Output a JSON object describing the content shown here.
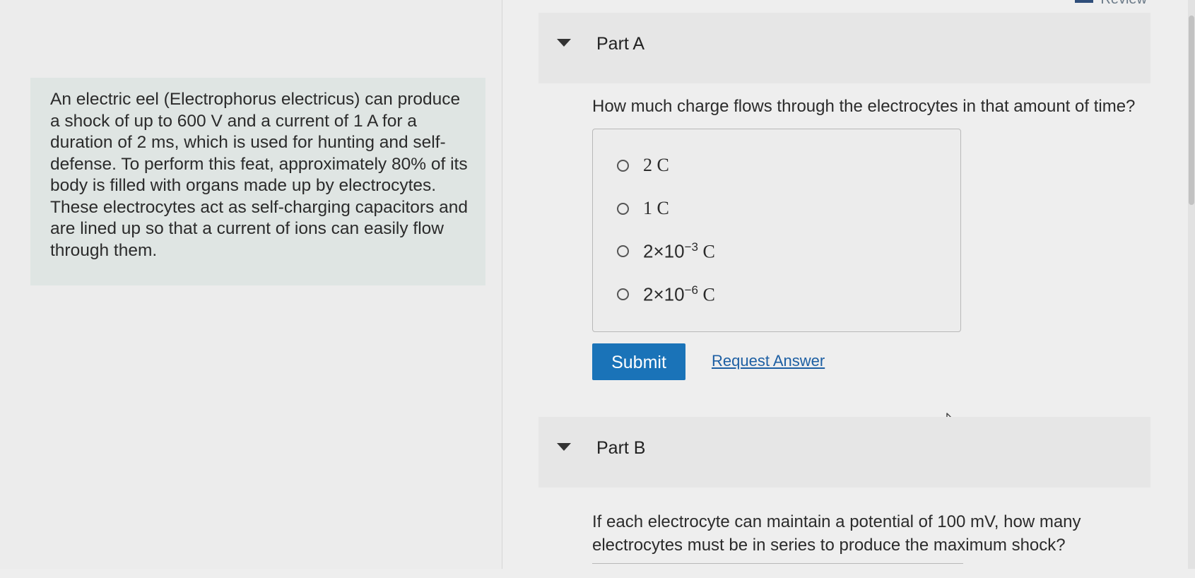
{
  "review": {
    "label": "Review"
  },
  "intro": {
    "paragraph": "An electric eel (Electrophorus electricus) can produce a shock of up to 600 V and a current of 1 A for a duration of 2 ms, which is used for hunting and self-defense. To perform this feat, approximately 80% of its body is filled with organs made up by electrocytes. These electrocytes act as self-charging capacitors and are lined up so that a current of ions can easily flow through them."
  },
  "part_a": {
    "title": "Part A",
    "question": "How much charge flows through the electrocytes in that amount of time?",
    "choices": [
      {
        "text": "2 C"
      },
      {
        "text": "1 C"
      },
      {
        "text": "2×10",
        "exp": "−3",
        "unit": " C"
      },
      {
        "text": "2×10",
        "exp": "−6",
        "unit": " C"
      }
    ],
    "submit_label": "Submit",
    "request_label": "Request Answer"
  },
  "part_b": {
    "title": "Part B",
    "question": "If each electrocyte can maintain a potential of 100 mV, how many electrocytes must be in series to produce the maximum shock?"
  },
  "icons": {
    "collapse": "triangle-down-icon",
    "cursor": "mouse-pointer-icon"
  }
}
